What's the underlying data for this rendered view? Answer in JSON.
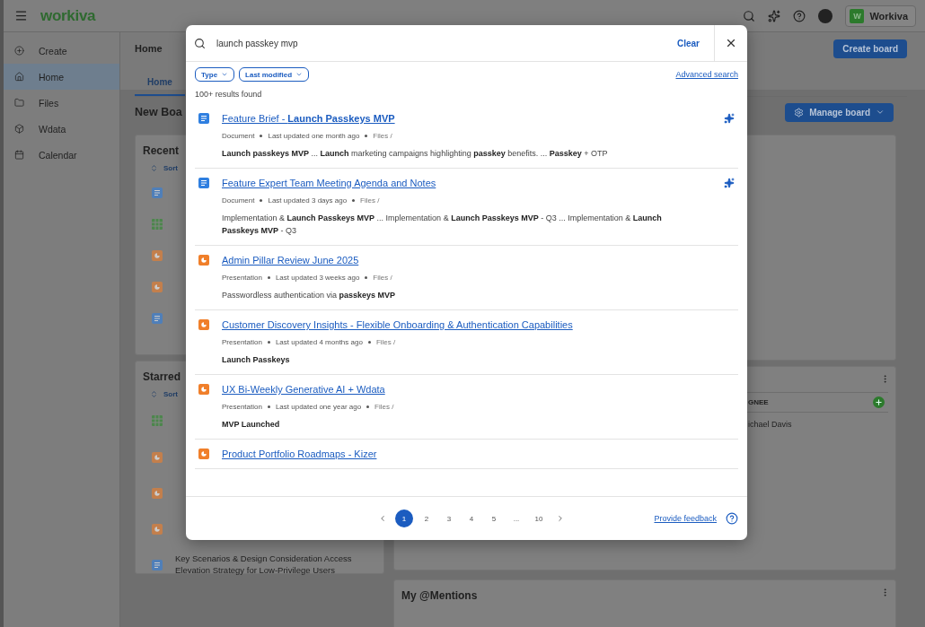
{
  "topbar": {
    "logo": "workiva",
    "org_initial": "W",
    "org_name": "Workiva"
  },
  "sidebar": {
    "items": [
      {
        "label": "Create",
        "selected": false
      },
      {
        "label": "Home",
        "selected": true
      },
      {
        "label": "Files",
        "selected": false
      },
      {
        "label": "Wdata",
        "selected": false
      },
      {
        "label": "Calendar",
        "selected": false
      }
    ]
  },
  "page": {
    "title": "Home",
    "create_button": "Create board",
    "tabs": [
      {
        "label": "Home",
        "selected": true
      }
    ],
    "board_title": "New Boa",
    "manage_button": "Manage board"
  },
  "recent_card": {
    "title": "Recent",
    "sort": "Sort",
    "items": [
      {
        "kind": "document"
      },
      {
        "kind": "spreadsheet"
      },
      {
        "kind": "presentation"
      },
      {
        "kind": "presentation"
      },
      {
        "kind": "document"
      }
    ]
  },
  "starred_card": {
    "title": "Starred",
    "sort": "Sort",
    "items": [
      {
        "kind": "spreadsheet"
      },
      {
        "kind": "presentation"
      },
      {
        "kind": "presentation"
      },
      {
        "kind": "presentation"
      },
      {
        "kind": "document",
        "title": "Key Scenarios & Design Consideration Access Elevation Strategy for Low-Privilege Users"
      }
    ]
  },
  "tasks_card": {
    "column_header": "GNEE",
    "rows": [
      "ichael Davis"
    ]
  },
  "mentions_card": {
    "title": "My @Mentions"
  },
  "search_dialog": {
    "query": "launch passkey mvp",
    "clear": "Clear",
    "filters": [
      "Type",
      "Last modified"
    ],
    "advanced_search": "Advanced search",
    "result_count": "100+ results found",
    "results": [
      {
        "kind": "document",
        "title": "Feature Brief - **Launch Passkeys MVP**",
        "type": "Document",
        "updated": "Last updated one month ago",
        "location": "Files /",
        "snippet": "**Launch passkeys MVP** ... **Launch** marketing campaigns highlighting **passkey** benefits. ... **Passkey** + OTP",
        "ai_suggested": true
      },
      {
        "kind": "document",
        "title": "Feature Expert Team Meeting Agenda and Notes",
        "type": "Document",
        "updated": "Last updated 3 days ago",
        "location": "Files /",
        "snippet": "Implementation & **Launch Passkeys MVP** ... Implementation & **Launch Passkeys MVP** - Q3 ... Implementation & **Launch Passkeys MVP** - Q3",
        "ai_suggested": true
      },
      {
        "kind": "presentation",
        "title": "Admin Pillar Review June 2025",
        "type": "Presentation",
        "updated": "Last updated 3 weeks ago",
        "location": "Files /",
        "snippet": "Passwordless authentication via **passkeys MVP**",
        "ai_suggested": false
      },
      {
        "kind": "presentation",
        "title": "Customer Discovery Insights - Flexible Onboarding & Authentication Capabilities",
        "type": "Presentation",
        "updated": "Last updated 4 months ago",
        "location": "Files /",
        "snippet": "**Launch Passkeys**",
        "ai_suggested": false
      },
      {
        "kind": "presentation",
        "title": "UX Bi-Weekly Generative AI + Wdata",
        "type": "Presentation",
        "updated": "Last updated one year ago",
        "location": "Files /",
        "snippet": "**MVP Launched**",
        "ai_suggested": false
      },
      {
        "kind": "presentation",
        "title": "Product Portfolio Roadmaps - Kizer",
        "ai_suggested": false
      }
    ],
    "pagination": {
      "pages": [
        {
          "label": "1",
          "selected": true
        },
        {
          "label": "2",
          "selected": false
        },
        {
          "label": "3",
          "selected": false
        },
        {
          "label": "4",
          "selected": false
        },
        {
          "label": "5",
          "selected": false
        },
        {
          "label": "...",
          "selected": false
        },
        {
          "label": "10",
          "selected": false
        }
      ]
    },
    "feedback": "Provide feedback"
  }
}
